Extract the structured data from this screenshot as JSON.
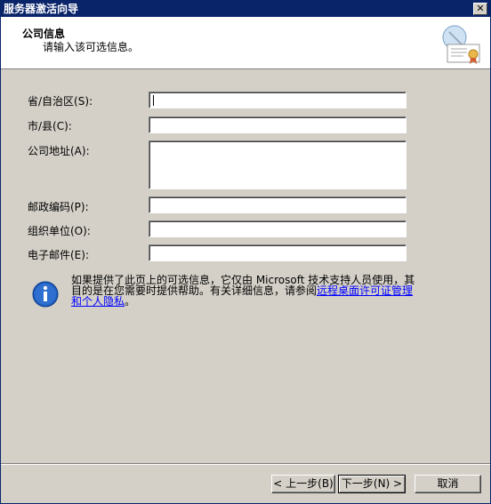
{
  "window": {
    "title": "服务器激活向导",
    "close_glyph": "✕"
  },
  "header": {
    "title": "公司信息",
    "subtitle": "请输入该可选信息。",
    "icon": "certificate-icon"
  },
  "form": {
    "province": {
      "label": "省/自治区(S):",
      "value": ""
    },
    "city": {
      "label": "市/县(C):",
      "value": ""
    },
    "address": {
      "label": "公司地址(A):",
      "value": ""
    },
    "postal": {
      "label": "邮政编码(P):",
      "value": ""
    },
    "org": {
      "label": "组织单位(O):",
      "value": ""
    },
    "email": {
      "label": "电子邮件(E):",
      "value": ""
    }
  },
  "info": {
    "icon": "info-icon",
    "text_before": "如果提供了此页上的可选信息，它仅由 Microsoft 技术支持人员使用，其目的是在您需要时提供帮助。有关详细信息，请参阅",
    "link_text": "远程桌面许可证管理和个人隐私",
    "text_after": "。"
  },
  "buttons": {
    "back": "< 上一步(B)",
    "next": "下一步(N) >",
    "cancel": "取消"
  },
  "colors": {
    "title_bar": "#0a246a",
    "dialog_bg": "#d4d0c8",
    "link": "#0000ff"
  }
}
